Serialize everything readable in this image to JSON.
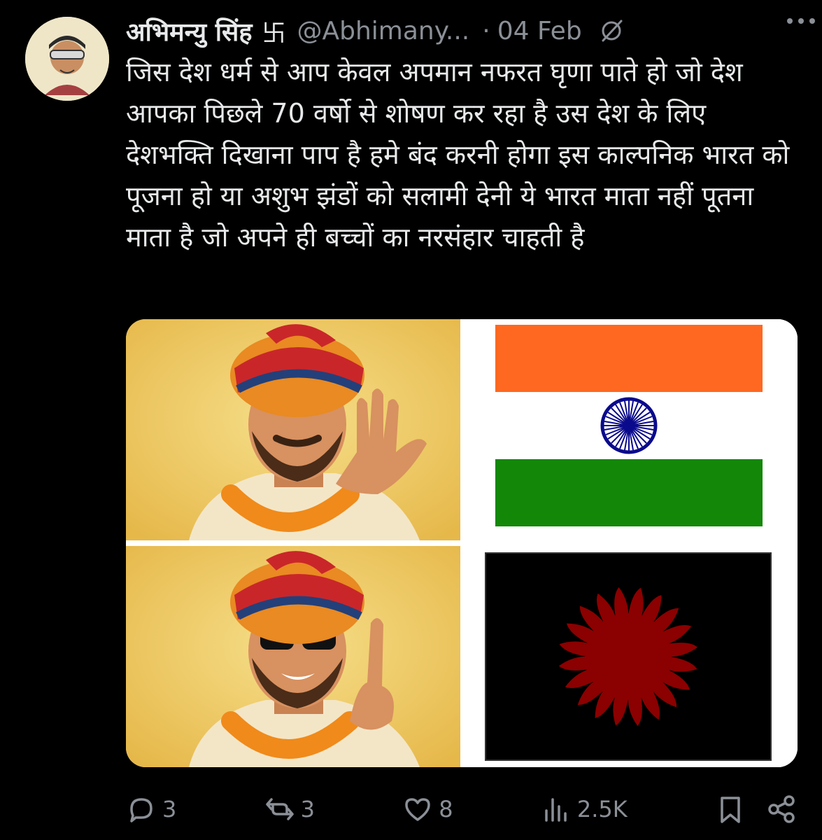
{
  "tweet": {
    "author_name": "अभिमन्यु सिंह",
    "author_badge": "卐",
    "handle": "@Abhimany...",
    "separator": "·",
    "time": "04 Feb",
    "text": "जिस देश धर्म से आप केवल अपमान नफरत घृणा पाते हो जो देश आपका पिछले 70 वर्षो से शोषण कर रहा है उस देश के लिए देशभक्ति दिखाना पाप है हमे बंद करनी होगा इस काल्पनिक भारत को पूजना हो या अशुभ झंडों को सलामी देनी ये भारत माता नहीं पूतना माता है जो अपने ही बच्चों का नरसंहार चाहती है"
  },
  "icons": {
    "avatar": "avatar-icon",
    "grok": "grok-icon",
    "more": "more-icon",
    "reply": "reply-icon",
    "retweet": "retweet-icon",
    "like": "heart-icon",
    "views": "views-icon",
    "bookmark": "bookmark-icon",
    "share": "share-icon"
  },
  "actions": {
    "replies": "3",
    "retweets": "3",
    "likes": "8",
    "views": "2.5K"
  },
  "colors": {
    "background": "#000000",
    "text": "#e7e9ea",
    "muted": "#8b9097",
    "flag_saffron": "#ff6820",
    "flag_green": "#138808",
    "chakra": "#0a0a8c",
    "sun_red": "#8b0000"
  }
}
